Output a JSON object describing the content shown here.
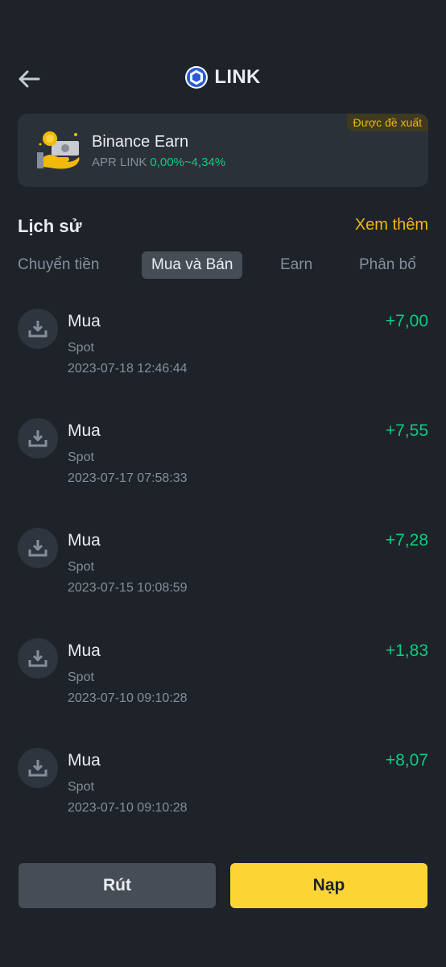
{
  "header": {
    "title": "LINK",
    "back_icon": "arrow-left-icon",
    "coin_icon": "chainlink-logo-icon"
  },
  "earn_card": {
    "badge": "Được đề xuất",
    "title": "Binance Earn",
    "apr_label": "APR LINK",
    "apr_range": "0,00%~4,34%",
    "icon": "coin-in-hand-icon"
  },
  "history": {
    "title": "Lịch sử",
    "see_more": "Xem thêm",
    "tabs": [
      {
        "label": "Chuyển tiền",
        "active": false
      },
      {
        "label": "Mua và Bán",
        "active": true
      },
      {
        "label": "Earn",
        "active": false
      },
      {
        "label": "Phân bổ",
        "active": false
      }
    ],
    "transactions": [
      {
        "type": "Mua",
        "account": "Spot",
        "date": "2023-07-18 12:46:44",
        "amount": "+7,00",
        "icon": "download-icon"
      },
      {
        "type": "Mua",
        "account": "Spot",
        "date": "2023-07-17 07:58:33",
        "amount": "+7,55",
        "icon": "download-icon"
      },
      {
        "type": "Mua",
        "account": "Spot",
        "date": "2023-07-15 10:08:59",
        "amount": "+7,28",
        "icon": "download-icon"
      },
      {
        "type": "Mua",
        "account": "Spot",
        "date": "2023-07-10 09:10:28",
        "amount": "+1,83",
        "icon": "download-icon"
      },
      {
        "type": "Mua",
        "account": "Spot",
        "date": "2023-07-10 09:10:28",
        "amount": "+8,07",
        "icon": "download-icon"
      }
    ]
  },
  "actions": {
    "withdraw": "Rút",
    "deposit": "Nạp"
  },
  "colors": {
    "background": "#1e2329",
    "accent": "#f0b90b",
    "positive": "#0ecb81",
    "primary_button": "#fcd535"
  }
}
